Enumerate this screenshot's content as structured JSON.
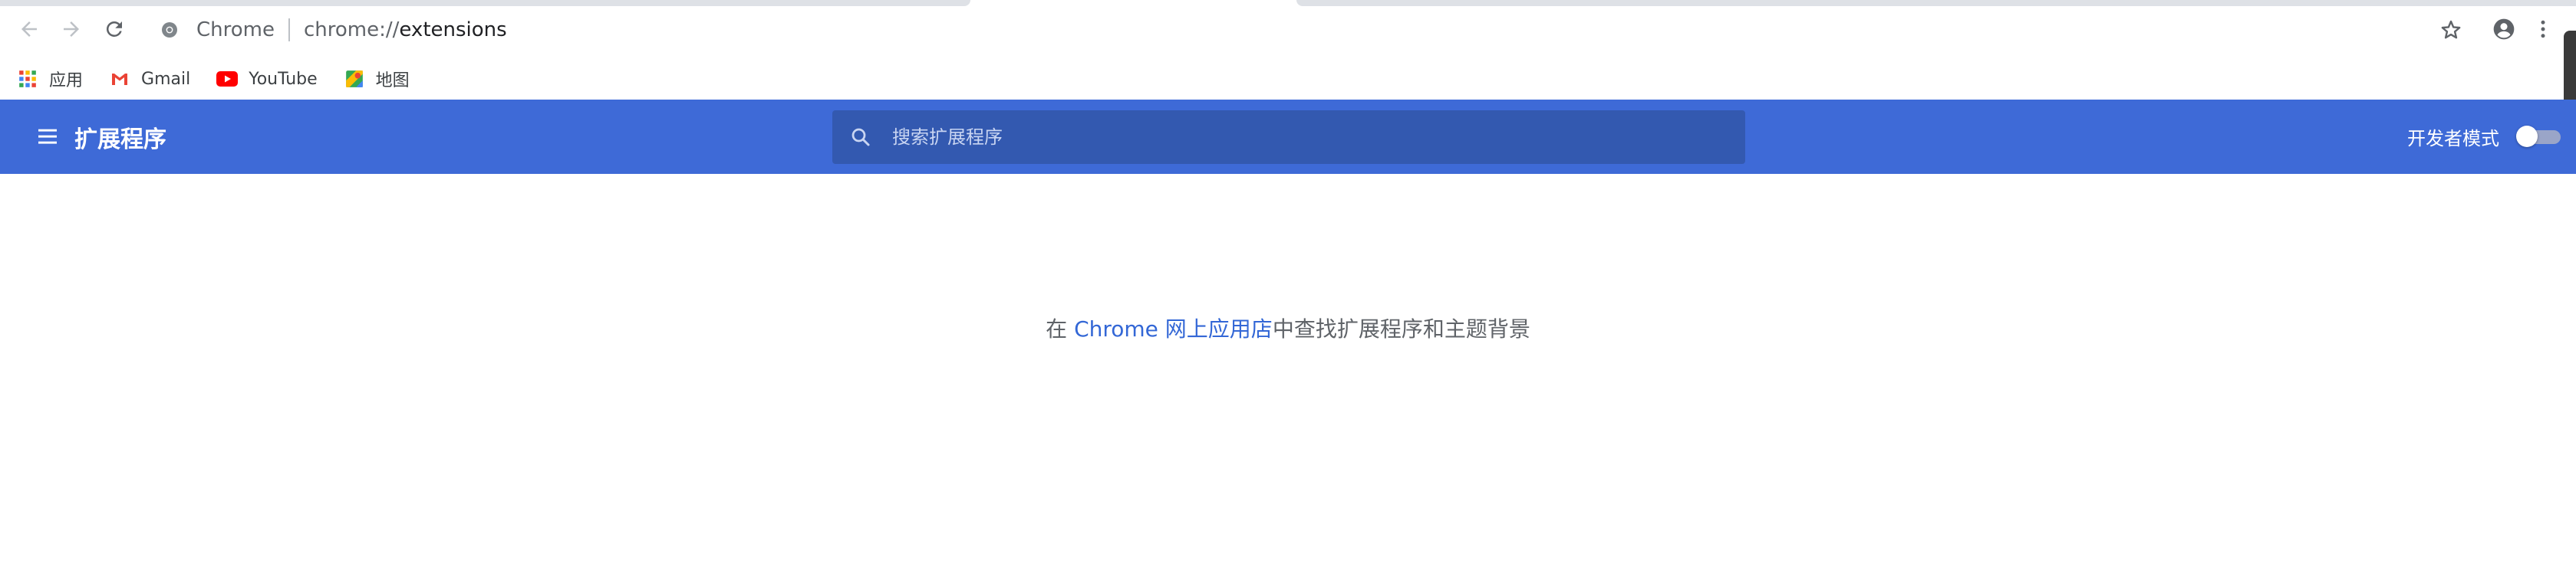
{
  "browser": {
    "site_name": "Chrome",
    "url_scheme_host": "chrome://",
    "url_path": "extensions"
  },
  "bookmarks": [
    {
      "label": "应用",
      "icon": "apps-grid-icon"
    },
    {
      "label": "Gmail",
      "icon": "gmail-icon"
    },
    {
      "label": "YouTube",
      "icon": "youtube-icon"
    },
    {
      "label": "地图",
      "icon": "maps-icon"
    }
  ],
  "extensions_page": {
    "title": "扩展程序",
    "search_placeholder": "搜索扩展程序",
    "dev_mode_label": "开发者模式",
    "dev_mode_enabled": false,
    "empty_prefix": "在 ",
    "store_link": "Chrome 网上应用店",
    "empty_suffix": "中查找扩展程序和主题背景"
  },
  "colors": {
    "header": "#3e6ad7",
    "search_bg": "#3359b0",
    "link": "#3367d6"
  }
}
